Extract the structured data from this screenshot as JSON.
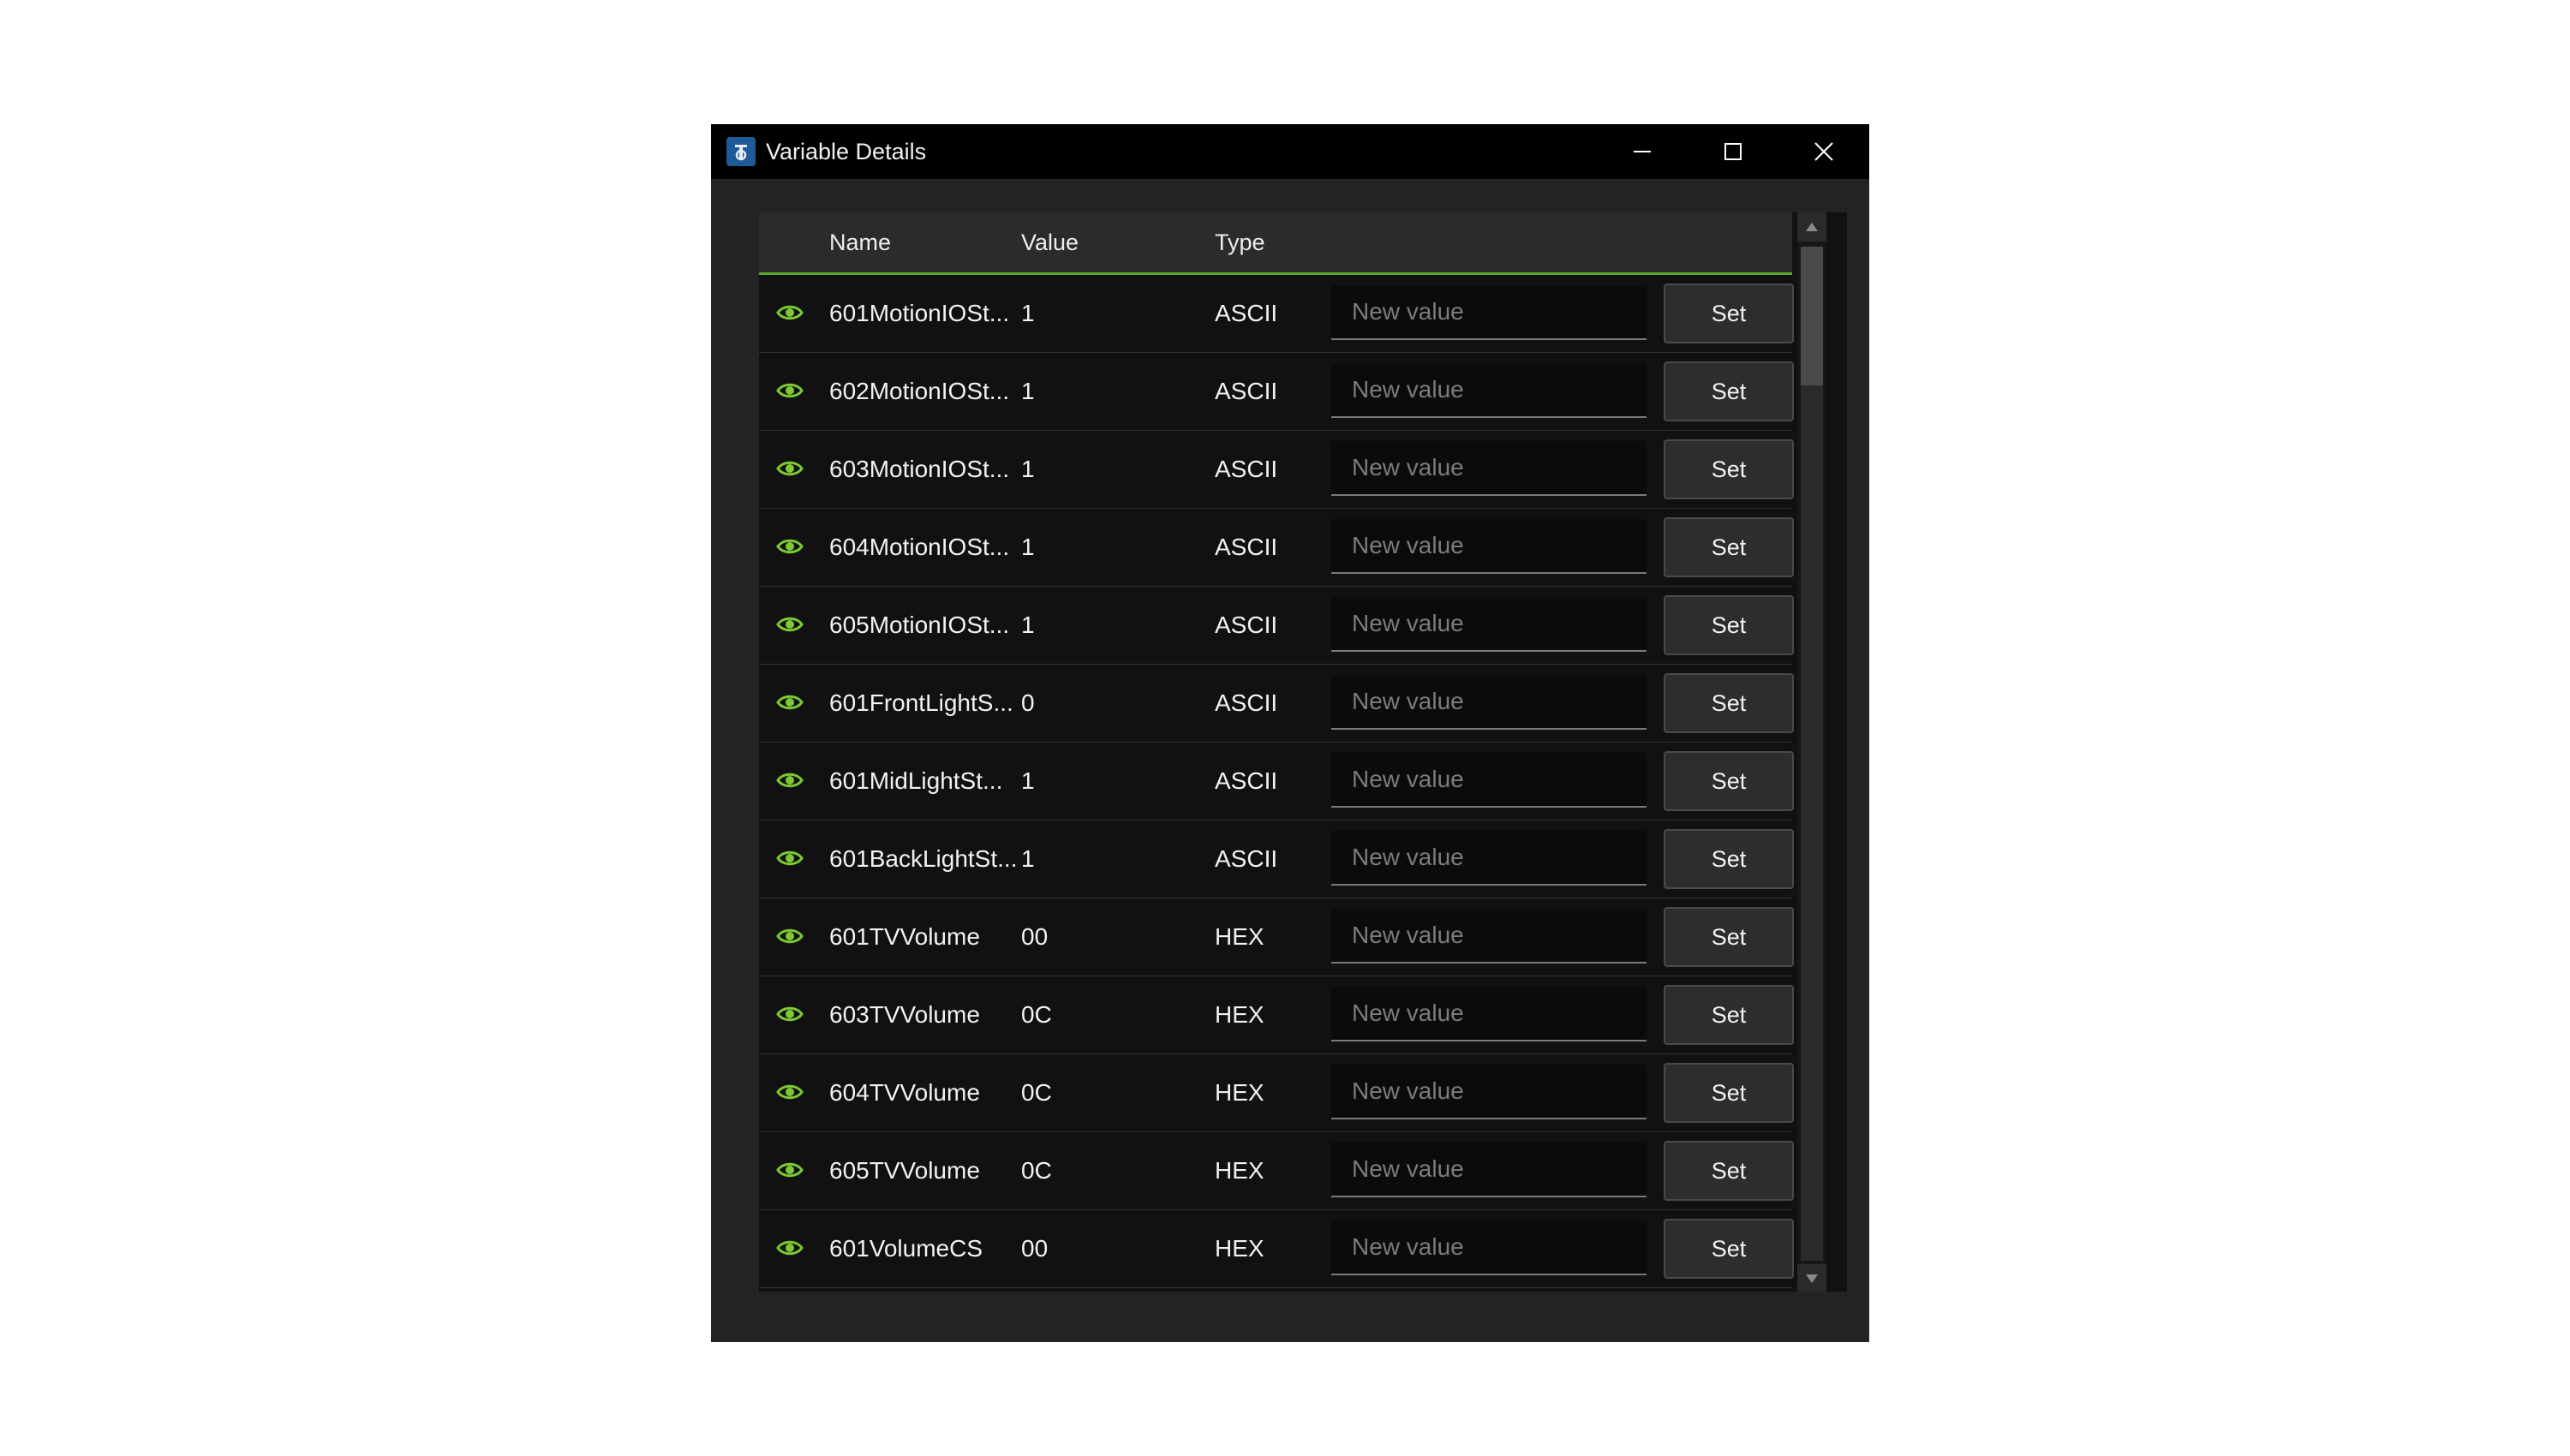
{
  "window": {
    "title": "Variable Details",
    "icon": "app-logo-icon",
    "controls": [
      "minimize-icon",
      "maximize-icon",
      "close-icon"
    ]
  },
  "table": {
    "columns": {
      "name": "Name",
      "value": "Value",
      "type": "Type"
    },
    "input_placeholder": "New value",
    "set_label": "Set",
    "rows": [
      {
        "name": "601MotionIOSt...",
        "value": "1",
        "type": "ASCII"
      },
      {
        "name": "602MotionIOSt...",
        "value": "1",
        "type": "ASCII"
      },
      {
        "name": "603MotionIOSt...",
        "value": "1",
        "type": "ASCII"
      },
      {
        "name": "604MotionIOSt...",
        "value": "1",
        "type": "ASCII"
      },
      {
        "name": "605MotionIOSt...",
        "value": "1",
        "type": "ASCII"
      },
      {
        "name": "601FrontLightS...",
        "value": "0",
        "type": "ASCII"
      },
      {
        "name": "601MidLightSt...",
        "value": "1",
        "type": "ASCII"
      },
      {
        "name": "601BackLightSt...",
        "value": "1",
        "type": "ASCII"
      },
      {
        "name": "601TVVolume",
        "value": "00",
        "type": "HEX"
      },
      {
        "name": "603TVVolume",
        "value": "0C",
        "type": "HEX"
      },
      {
        "name": "604TVVolume",
        "value": "0C",
        "type": "HEX"
      },
      {
        "name": "605TVVolume",
        "value": "0C",
        "type": "HEX"
      },
      {
        "name": "601VolumeCS",
        "value": "00",
        "type": "HEX"
      },
      {
        "name": "",
        "value": "",
        "type": ""
      }
    ]
  },
  "colors": {
    "accent_green": "#5aa62a",
    "eye_icon": "#7cc934",
    "window_bg": "#232323",
    "titlebar_bg": "#000000"
  }
}
